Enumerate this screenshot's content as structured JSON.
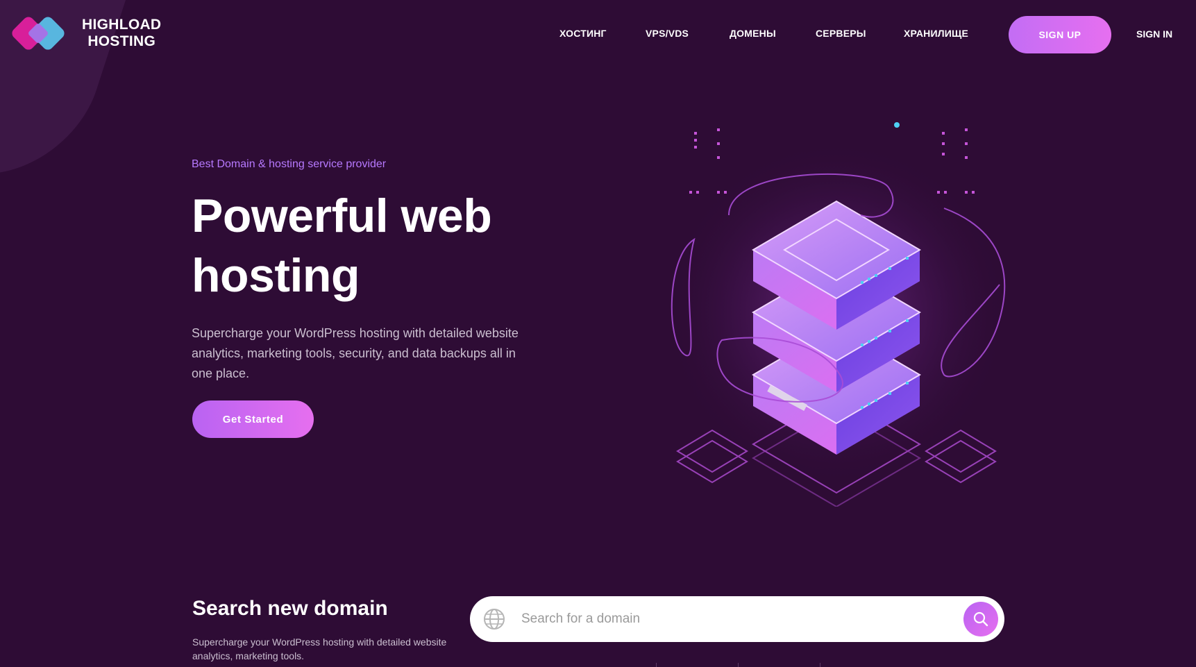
{
  "brand": {
    "line1": "HIGHLOAD",
    "line2": "HOSTING"
  },
  "nav": {
    "items": [
      "ХОСТИНГ",
      "VPS/VDS",
      "ДОМЕНЫ",
      "СЕРВЕРЫ",
      "ХРАНИЛИЩЕ"
    ],
    "signup_label": "SIGN UP",
    "signin_label": "SIGN IN"
  },
  "hero": {
    "eyebrow": "Best Domain & hosting service provider",
    "title_line1": "Powerful web",
    "title_line2": "hosting",
    "description": "Supercharge your WordPress hosting with detailed website analytics, marketing tools, security, and data backups all in one place.",
    "cta_label": "Get Started"
  },
  "search": {
    "title": "Search new domain",
    "description": "Supercharge your WordPress hosting with detailed website analytics, marketing tools.",
    "placeholder": "Search for a domain"
  },
  "colors": {
    "background": "#2e0c35",
    "accent_purple": "#c36df4",
    "accent_pink": "#e66ff0",
    "eyebrow": "#b779ff"
  },
  "icons": [
    "logo-mark",
    "globe-icon",
    "search-icon",
    "server-illustration"
  ]
}
